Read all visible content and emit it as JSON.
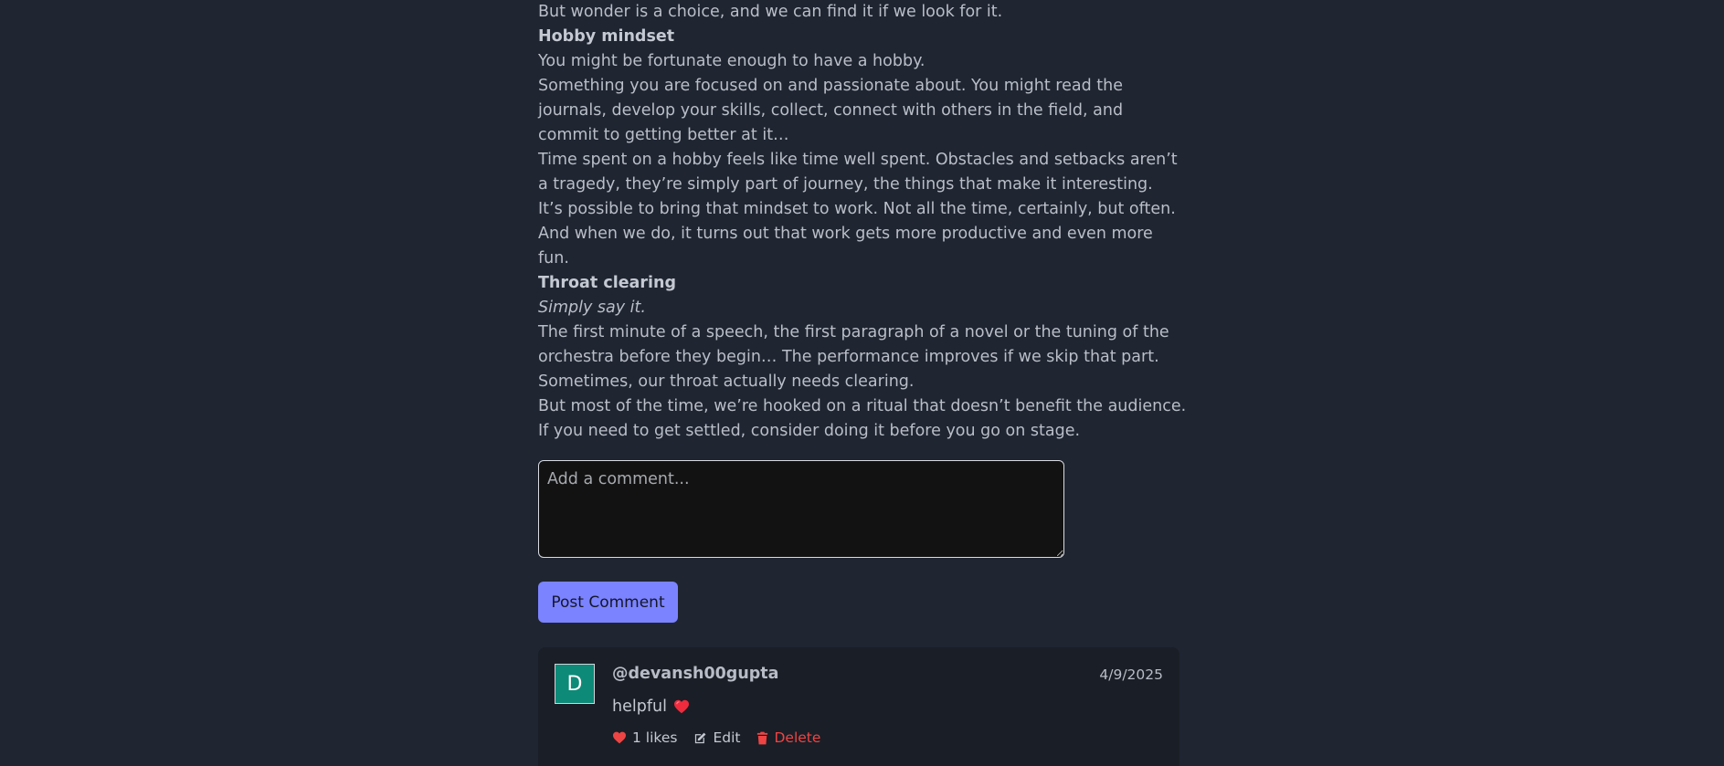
{
  "article": {
    "lines": [
      {
        "text": "But wonder is a choice, and we can find it if we look for it.",
        "style": "normal"
      },
      {
        "text": "Hobby mindset",
        "style": "heading"
      },
      {
        "text": "You might be fortunate enough to have a hobby.",
        "style": "normal"
      },
      {
        "text": "Something you are focused on and passionate about. You might read the journals, develop your skills, collect, connect with others in the field, and commit to getting better at it…",
        "style": "normal"
      },
      {
        "text": "Time spent on a hobby feels like time well spent. Obstacles and setbacks aren’t a tragedy, they’re simply part of journey, the things that make it interesting.",
        "style": "normal"
      },
      {
        "text": "It’s possible to bring that mindset to work. Not all the time, certainly, but often. And when we do, it turns out that work gets more productive and even more fun.",
        "style": "normal"
      },
      {
        "text": "Throat clearing",
        "style": "heading"
      },
      {
        "text": "Simply say it.",
        "style": "italic"
      },
      {
        "text": "The first minute of a speech, the first paragraph of a novel or the tuning of the orchestra before they begin… The performance improves if we skip that part.",
        "style": "normal"
      },
      {
        "text": "Sometimes, our throat actually needs clearing.",
        "style": "normal"
      },
      {
        "text": "But most of the time, we’re hooked on a ritual that doesn’t benefit the audience.",
        "style": "normal"
      },
      {
        "text": "If you need to get settled, consider doing it before you go on stage.",
        "style": "normal"
      }
    ]
  },
  "comment_form": {
    "placeholder": "Add a comment...",
    "value": "",
    "submit_label": "Post Comment"
  },
  "comments": [
    {
      "avatar_letter": "D",
      "avatar_color": "#0e8a78",
      "username": "@devansh00gupta",
      "date": "4/9/2025",
      "text": "helpful",
      "emoji_icon": "red-heart-icon",
      "likes_label": "1 likes",
      "edit_label": "Edit",
      "delete_label": "Delete"
    }
  ],
  "colors": {
    "background": "#1f2531",
    "accent_button": "#7b83ff",
    "delete": "#ef4444",
    "heart": "#ef4444"
  }
}
